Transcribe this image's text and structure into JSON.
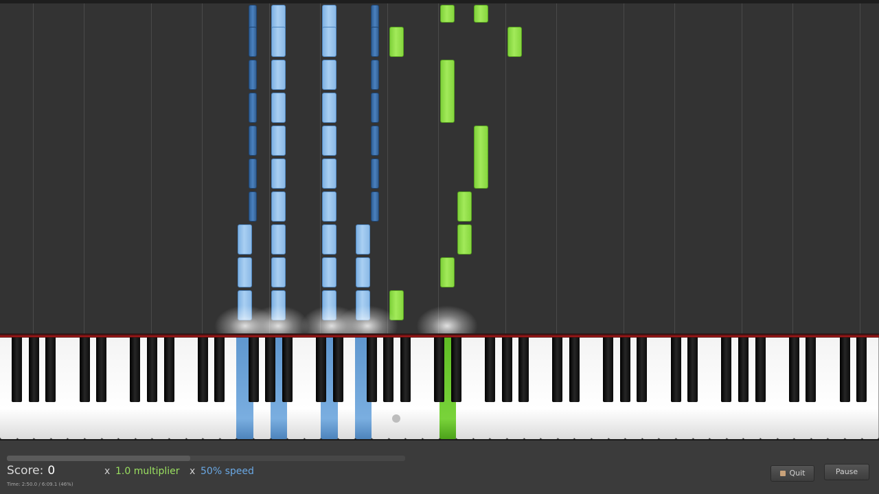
{
  "score": {
    "label": "Score:",
    "value": "0"
  },
  "time": {
    "text": "Time:   2:50.0 / 6:09.1 (46%)"
  },
  "multiplier": {
    "prefix": "x",
    "text": "1.0 multiplier"
  },
  "speed": {
    "prefix": "x",
    "text": "50% speed"
  },
  "buttons": {
    "quit": "Quit",
    "pause": "Pause"
  },
  "icons": {
    "quit": "stop-square-icon"
  },
  "playback": {
    "progress_fraction": 0.46
  },
  "colors": {
    "left_hand": "#7aaee0",
    "right_hand": "#79d33a",
    "background": "#333333"
  }
}
